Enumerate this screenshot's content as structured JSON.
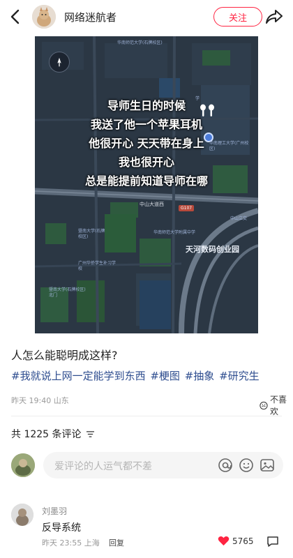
{
  "header": {
    "author_name": "网络迷航者",
    "follow_label": "关注"
  },
  "image": {
    "caption_lines": [
      "导师生日的时候",
      "我送了他一个苹果耳机",
      "他很开心 天天带在身上",
      "我也很开心",
      "总是能提前知道导师在哪"
    ],
    "map_labels": {
      "top_center": "华南师范大学(石牌校区)",
      "top_center_sub": "学",
      "right_mid": "华南理工大学(广州校区)",
      "road_main": "中山大道西",
      "road_shield": "G107",
      "road_right": "中山立交",
      "tianhe": "天河数码创业园",
      "school_left": "暨南大学(石牌校区)",
      "school_mid": "华南师范大学附属中学",
      "school_left2": "广州华侨学生补习学校",
      "school_bottom": "暨南大学(石牌校区)北门"
    }
  },
  "post": {
    "title": "人怎么能聪明成这样?",
    "tags": [
      "#我就说上网一定能学到东西",
      "#梗图",
      "#抽象",
      "#研究生"
    ],
    "date": "昨天 19:40",
    "location": "山东",
    "dislike_label": "不喜欢"
  },
  "comments": {
    "count_label": "共 1225 条评论",
    "input_placeholder": "爱评论的人运气都不差",
    "items": [
      {
        "name": "刘墨羽",
        "text": "反导系统",
        "date": "昨天 23:55",
        "location": "上海",
        "reply_label": "回复",
        "likes": "5765"
      }
    ]
  },
  "colors": {
    "accent": "#ff2442",
    "tag": "#2e4d8f",
    "map_bg": "#2b3744"
  },
  "icons": [
    "back-arrow-icon",
    "share-icon",
    "airpods-icon",
    "location-pin-icon",
    "dislike-icon",
    "sort-icon",
    "at-icon",
    "emoji-icon",
    "image-icon",
    "heart-icon",
    "comment-icon"
  ]
}
